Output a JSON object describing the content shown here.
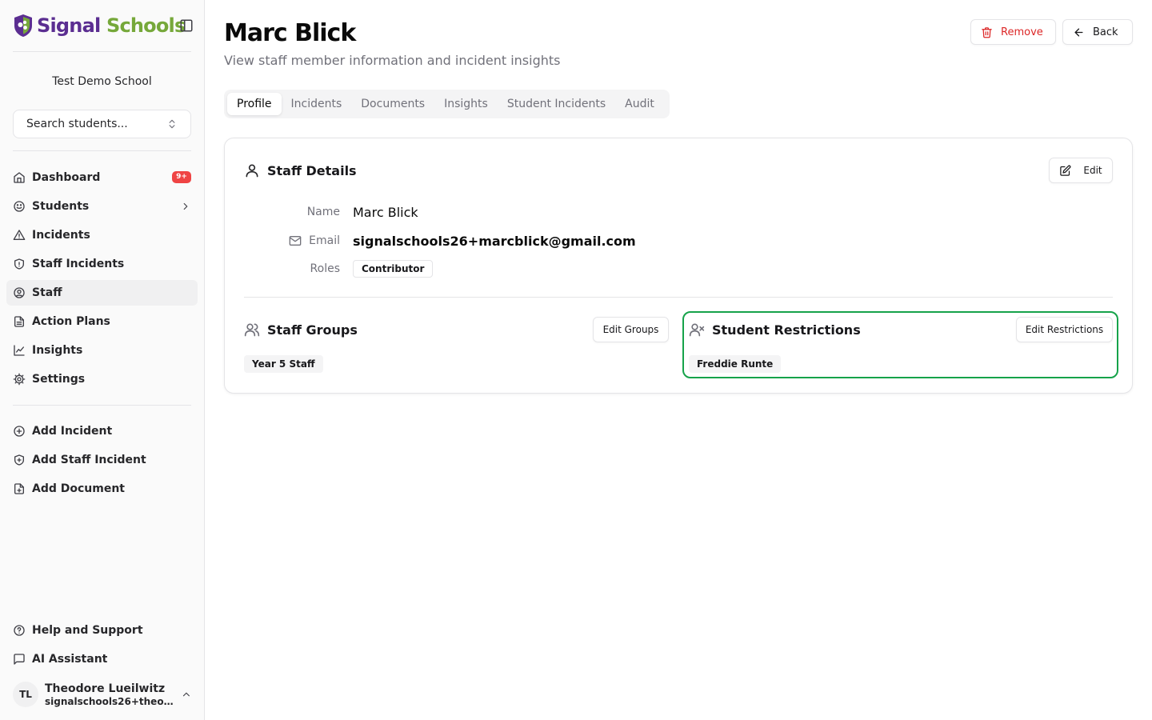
{
  "brand": {
    "part1": "Signal",
    "part2": "Schools"
  },
  "colors": {
    "brand_purple": "#5b2e91",
    "brand_green": "#76a83a",
    "danger": "#dc2626",
    "highlight": "#16a34a",
    "badge": "#ef4444"
  },
  "sidebar": {
    "school_name": "Test Demo School",
    "search_placeholder": "Search students...",
    "nav": [
      {
        "label": "Dashboard",
        "icon": "home-icon",
        "badge": "9+"
      },
      {
        "label": "Students",
        "icon": "smile-icon"
      },
      {
        "label": "Incidents",
        "icon": "alert-triangle-icon"
      },
      {
        "label": "Staff Incidents",
        "icon": "shield-icon"
      },
      {
        "label": "Staff",
        "icon": "user-circle-icon",
        "active": true
      },
      {
        "label": "Action Plans",
        "icon": "file-text-icon"
      },
      {
        "label": "Insights",
        "icon": "chart-line-icon"
      },
      {
        "label": "Settings",
        "icon": "gear-icon"
      }
    ],
    "quick_actions": [
      {
        "label": "Add Incident",
        "icon": "plus-circle-icon"
      },
      {
        "label": "Add Staff Incident",
        "icon": "shield-plus-icon"
      },
      {
        "label": "Add Document",
        "icon": "file-plus-icon"
      }
    ],
    "footer": [
      {
        "label": "Help and Support",
        "icon": "help-circle-icon"
      },
      {
        "label": "AI Assistant",
        "icon": "message-square-icon"
      }
    ],
    "user": {
      "initials": "TL",
      "name": "Theodore Lueilwitz",
      "email": "signalschools26+theodo..."
    }
  },
  "header": {
    "title": "Marc Blick",
    "subtitle": "View staff member information and incident insights",
    "remove_label": "Remove",
    "back_label": "Back"
  },
  "tabs": [
    {
      "label": "Profile",
      "active": true
    },
    {
      "label": "Incidents"
    },
    {
      "label": "Documents"
    },
    {
      "label": "Insights"
    },
    {
      "label": "Student Incidents"
    },
    {
      "label": "Audit"
    }
  ],
  "staff_details": {
    "title": "Staff Details",
    "edit_label": "Edit",
    "name_label": "Name",
    "name_value": "Marc Blick",
    "email_label": "Email",
    "email_value": "signalschools26+marcblick@gmail.com",
    "roles_label": "Roles",
    "roles": [
      "Contributor"
    ]
  },
  "staff_groups": {
    "title": "Staff Groups",
    "edit_label": "Edit Groups",
    "groups": [
      "Year 5 Staff"
    ]
  },
  "student_restrictions": {
    "title": "Student Restrictions",
    "edit_label": "Edit Restrictions",
    "students": [
      "Freddie Runte"
    ]
  }
}
